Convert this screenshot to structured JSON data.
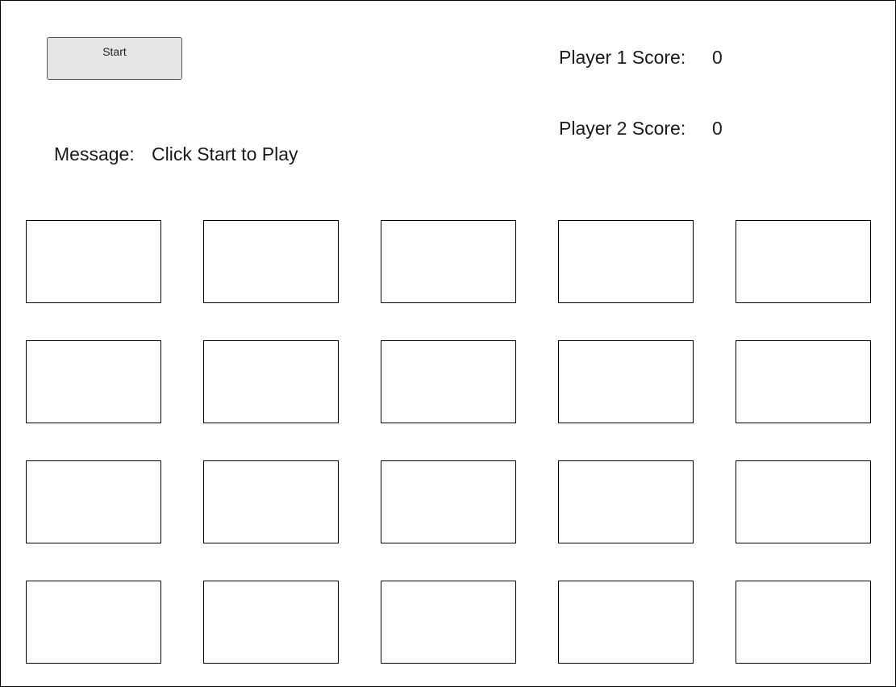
{
  "controls": {
    "start_label": "Start"
  },
  "message": {
    "label": "Message:",
    "value": "Click Start to Play"
  },
  "scores": {
    "player1_label": "Player 1 Score:",
    "player1_value": "0",
    "player2_label": "Player 2 Score:",
    "player2_value": "0"
  },
  "board": {
    "rows": 4,
    "columns": 5,
    "cards": [
      {
        "face": ""
      },
      {
        "face": ""
      },
      {
        "face": ""
      },
      {
        "face": ""
      },
      {
        "face": ""
      },
      {
        "face": ""
      },
      {
        "face": ""
      },
      {
        "face": ""
      },
      {
        "face": ""
      },
      {
        "face": ""
      },
      {
        "face": ""
      },
      {
        "face": ""
      },
      {
        "face": ""
      },
      {
        "face": ""
      },
      {
        "face": ""
      },
      {
        "face": ""
      },
      {
        "face": ""
      },
      {
        "face": ""
      },
      {
        "face": ""
      },
      {
        "face": ""
      }
    ]
  }
}
